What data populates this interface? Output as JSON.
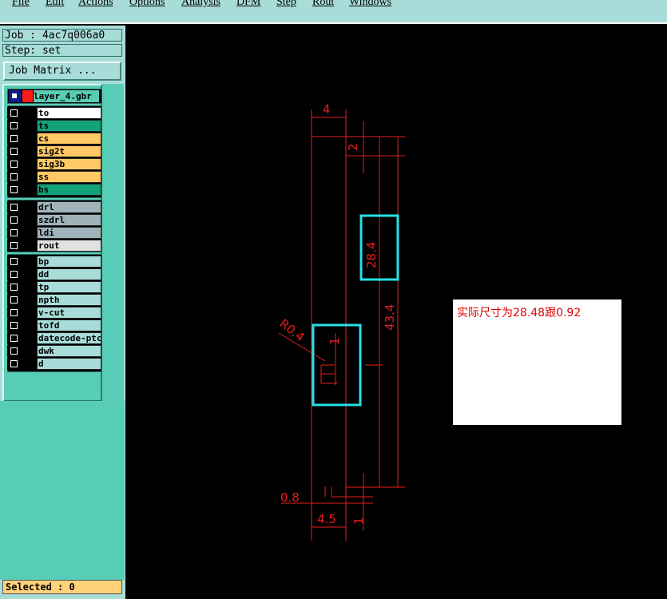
{
  "menubar": {
    "items": [
      "File",
      "Edit",
      "Actions",
      "Options",
      "Analysis",
      "DFM",
      "Step",
      "Rout",
      "Windows"
    ]
  },
  "job_label": "Job : 4ac7q006a0",
  "step_label": "Step: set",
  "job_matrix_button": "Job Matrix ...",
  "layer_header_name": "layer_4.gbr",
  "layers_group1": [
    {
      "name": "to",
      "color": "#ffffff"
    },
    {
      "name": "ts",
      "color": "#13a37b"
    },
    {
      "name": "cs",
      "color": "#ffc864"
    },
    {
      "name": "sig2t",
      "color": "#ffc864"
    },
    {
      "name": "sig3b",
      "color": "#ffc864"
    },
    {
      "name": "ss",
      "color": "#ffc864"
    },
    {
      "name": "bs",
      "color": "#13a37b"
    }
  ],
  "layers_group2": [
    {
      "name": "drl",
      "color": "#9fb3b9"
    },
    {
      "name": "szdrl",
      "color": "#9fb3b9"
    },
    {
      "name": "ldi",
      "color": "#9fb3b9"
    },
    {
      "name": "rout",
      "color": "#e1e1e1"
    }
  ],
  "layers_group3": [
    {
      "name": "bp",
      "color": "#a8dcd8"
    },
    {
      "name": "dd",
      "color": "#a8dcd8"
    },
    {
      "name": "tp",
      "color": "#a8dcd8"
    },
    {
      "name": "npth",
      "color": "#a8dcd8"
    },
    {
      "name": "v-cut",
      "color": "#a8dcd8"
    },
    {
      "name": "tofd",
      "color": "#a8dcd8"
    },
    {
      "name": "datecode-ptc",
      "color": "#a8dcd8"
    },
    {
      "name": "dwk",
      "color": "#a8dcd8"
    },
    {
      "name": "d",
      "color": "#a8dcd8"
    }
  ],
  "selected_label": "Selected : 0",
  "drawing": {
    "dim_top_width": "4",
    "dim_top_gap": "2",
    "dim_slot_length": "28.4",
    "dim_total_length": "43.4",
    "dim_radius": "R0.4",
    "dim_small": "1",
    "dim_bottom_gap": "0.8",
    "dim_bottom_width": "4.5",
    "dim_bottom_small": "1",
    "line_color": "#e61e1e",
    "highlight_color": "#26e0e6"
  },
  "note_text": "实际尺寸为28.48跟0.92"
}
